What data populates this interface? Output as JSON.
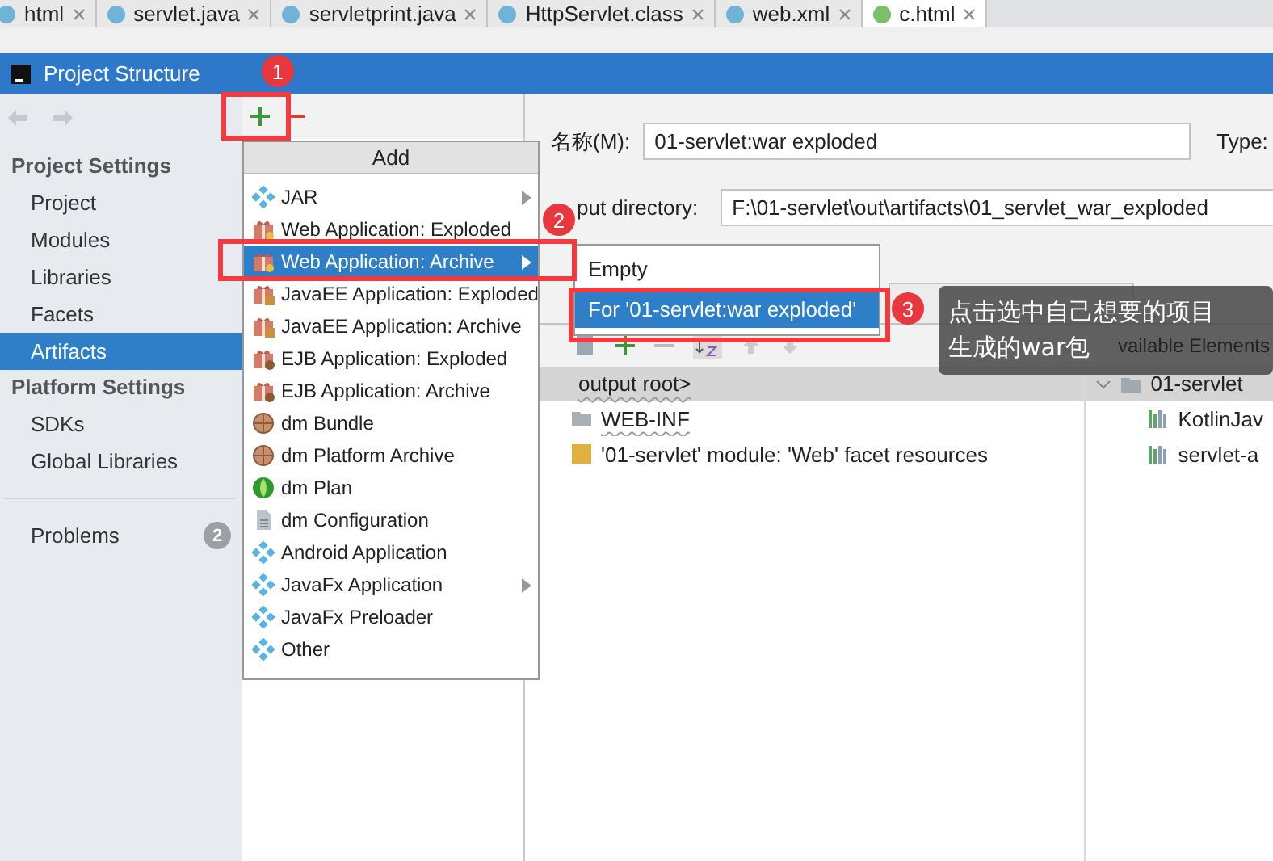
{
  "editor_tabs": [
    {
      "label": "html",
      "selected": false
    },
    {
      "label": "servlet.java",
      "selected": false
    },
    {
      "label": "servletprint.java",
      "selected": false
    },
    {
      "label": "HttpServlet.class",
      "selected": false
    },
    {
      "label": "web.xml",
      "selected": false
    },
    {
      "label": "c.html",
      "selected": true
    }
  ],
  "window": {
    "title": "Project Structure"
  },
  "sidebar": {
    "sections": [
      {
        "heading": "Project Settings",
        "items": [
          {
            "label": "Project",
            "selected": false
          },
          {
            "label": "Modules",
            "selected": false
          },
          {
            "label": "Libraries",
            "selected": false
          },
          {
            "label": "Facets",
            "selected": false
          },
          {
            "label": "Artifacts",
            "selected": true
          }
        ]
      },
      {
        "heading": "Platform Settings",
        "items": [
          {
            "label": "SDKs",
            "selected": false
          },
          {
            "label": "Global Libraries",
            "selected": false
          }
        ]
      }
    ],
    "problems": {
      "label": "Problems",
      "count": "2"
    }
  },
  "details": {
    "name_label": "名称(M):",
    "name_value": "01-servlet:war exploded",
    "type_label": "Type:",
    "output_label": "put directory:",
    "output_value": "F:\\01-servlet\\out\\artifacts\\01_servlet_war_exploded",
    "available_label": "vailable Elements",
    "layout_tree": [
      {
        "label": "output root>",
        "children": [
          {
            "label": "WEB-INF",
            "kind": "folder"
          },
          {
            "label": "'01-servlet' module: 'Web' facet resources",
            "kind": "module"
          }
        ]
      }
    ],
    "available_tree": [
      {
        "label": "01-servlet",
        "expanded": true,
        "children": [
          {
            "label": "KotlinJav"
          },
          {
            "label": "servlet-a"
          }
        ]
      }
    ]
  },
  "add_menu": {
    "title": "Add",
    "items": [
      {
        "label": "JAR",
        "kind": "diamond",
        "submenu": true,
        "selected": false
      },
      {
        "label": "Web Application: Exploded",
        "kind": "gift",
        "submenu": false,
        "selected": false
      },
      {
        "label": "Web Application: Archive",
        "kind": "gift",
        "submenu": true,
        "selected": true
      },
      {
        "label": "JavaEE Application: Exploded",
        "kind": "gift-ee",
        "submenu": false,
        "selected": false
      },
      {
        "label": "JavaEE Application: Archive",
        "kind": "gift-ee",
        "submenu": false,
        "selected": false
      },
      {
        "label": "EJB Application: Exploded",
        "kind": "gift-ejb",
        "submenu": false,
        "selected": false
      },
      {
        "label": "EJB Application: Archive",
        "kind": "gift-ejb",
        "submenu": false,
        "selected": false
      },
      {
        "label": "dm Bundle",
        "kind": "globe",
        "submenu": false,
        "selected": false
      },
      {
        "label": "dm Platform Archive",
        "kind": "globe",
        "submenu": false,
        "selected": false
      },
      {
        "label": "dm Plan",
        "kind": "plan",
        "submenu": false,
        "selected": false
      },
      {
        "label": "dm Configuration",
        "kind": "doc",
        "submenu": false,
        "selected": false
      },
      {
        "label": "Android Application",
        "kind": "diamond",
        "submenu": false,
        "selected": false
      },
      {
        "label": "JavaFx Application",
        "kind": "diamond",
        "submenu": true,
        "selected": false
      },
      {
        "label": "JavaFx Preloader",
        "kind": "diamond",
        "submenu": false,
        "selected": false
      },
      {
        "label": "Other",
        "kind": "diamond",
        "submenu": false,
        "selected": false
      }
    ]
  },
  "submenu": {
    "items": [
      {
        "label": "Empty",
        "selected": false
      },
      {
        "label": "For '01-servlet:war exploded'",
        "selected": true
      }
    ]
  },
  "annotations": {
    "steps": [
      "1",
      "2",
      "3"
    ],
    "note": [
      "点击选中自己想要的项目",
      "生成的war包"
    ]
  }
}
